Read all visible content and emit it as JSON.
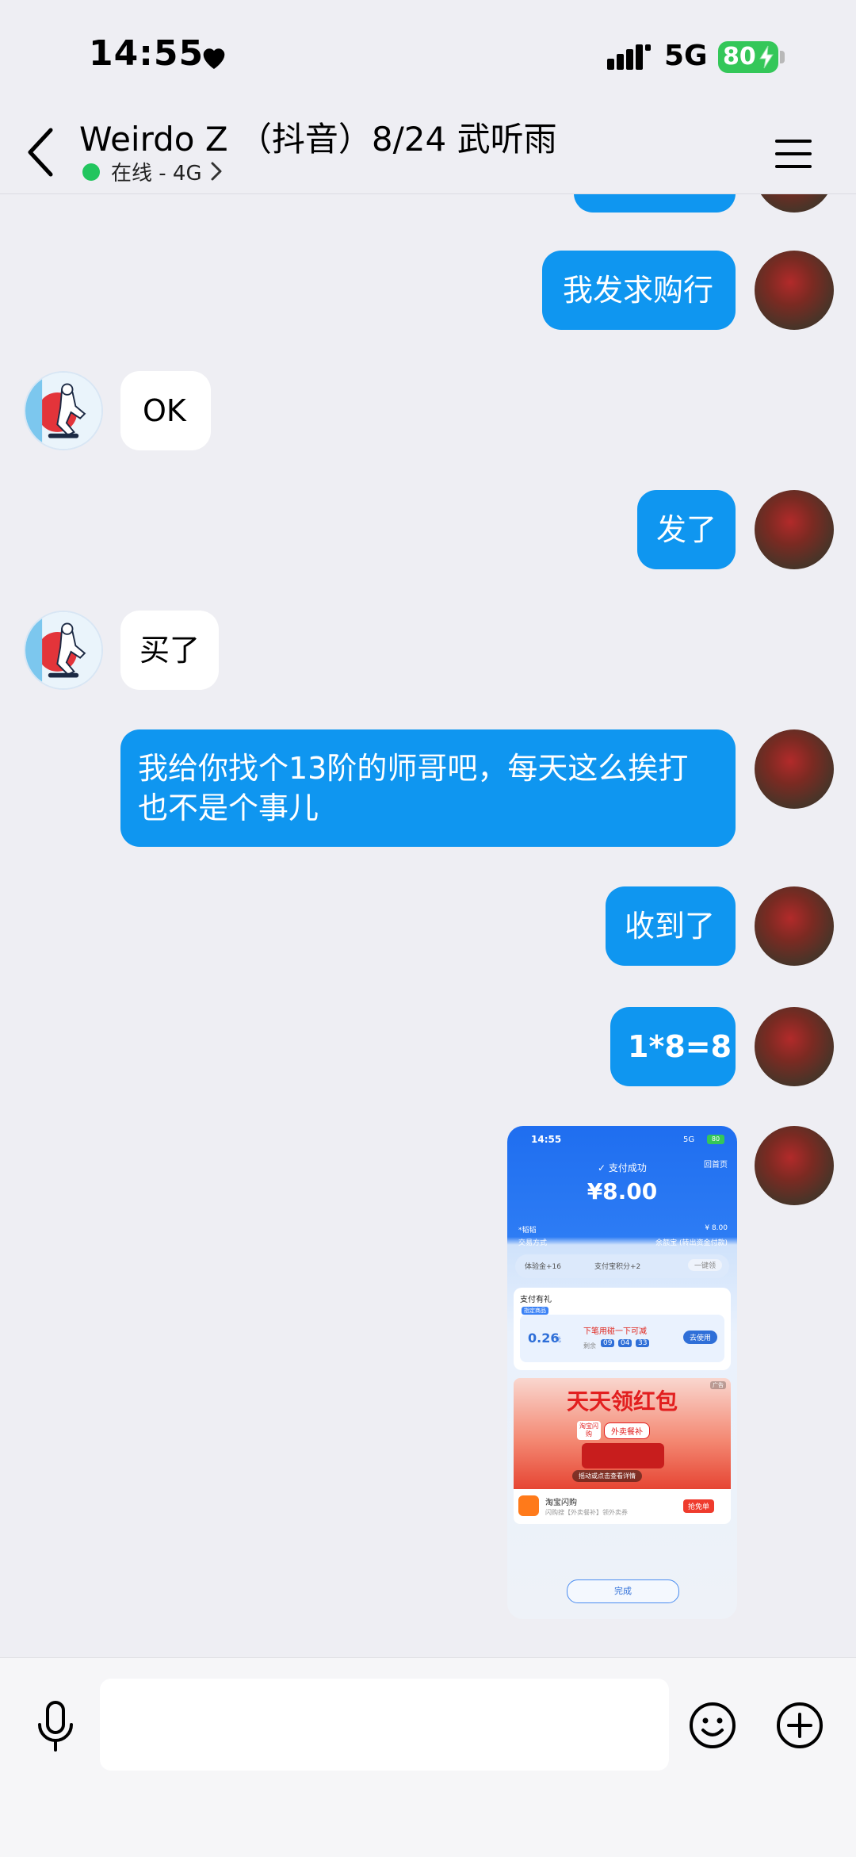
{
  "status_bar": {
    "time": "14:55",
    "network": "5G",
    "battery": "80"
  },
  "header": {
    "contact_name": "Weirdo Z （抖音）8/24 武听雨",
    "online_status": "在线 - 4G"
  },
  "messages": [
    {
      "side": "out",
      "text": "我发求购行"
    },
    {
      "side": "in",
      "text": "OK"
    },
    {
      "side": "out",
      "text": "发了"
    },
    {
      "side": "in",
      "text": "买了"
    },
    {
      "side": "out",
      "text": "我给你找个13阶的师哥吧，每天这么挨打\n也不是个事儿"
    },
    {
      "side": "out",
      "text": "收到了"
    },
    {
      "side": "out",
      "text": "1*8=8"
    }
  ],
  "payment_screenshot": {
    "time": "14:55",
    "network": "5G",
    "battery": "80",
    "title": "支付成功",
    "home_link": "回首页",
    "amount": "¥8.00",
    "row1_label": "*韬韬",
    "row1_value": "¥ 8.00",
    "row2_label": "交易方式",
    "row2_value": "余额宝 (转出资金付款)",
    "reward_1": "体验金+16",
    "reward_2": "支付宝积分+2",
    "reward_button": "一键领",
    "gift_title": "支付有礼",
    "gift_badge": "指定商品",
    "coupon_value": "0.26",
    "coupon_unit": "元",
    "coupon_text": "下笔用碰一下可减",
    "countdown_label": "剩余",
    "countdown": [
      "09",
      "04",
      "33"
    ],
    "coupon_button": "去使用",
    "ad_tag": "广告",
    "banner_title": "天天领红包",
    "banner_badge": "淘宝闪购",
    "banner_search": "外卖餐补",
    "banner_tip": "摇动或点击查看详情",
    "shop_name": "淘宝闪购",
    "shop_desc": "闪购搜【外卖餐补】领外卖券",
    "shop_button": "抢免单",
    "done_button": "完成"
  },
  "icons": {
    "back": "chevron-left",
    "menu": "hamburger",
    "mic": "microphone",
    "emoji": "smiley",
    "add": "plus-circle"
  },
  "colors": {
    "outgoing_bubble": "#0f96f0",
    "incoming_bubble": "#ffffff",
    "online": "#22c55e",
    "battery": "#34c759"
  }
}
